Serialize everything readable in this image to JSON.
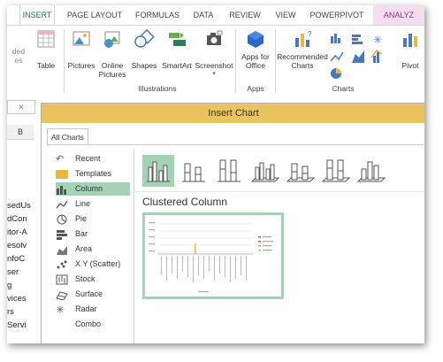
{
  "ribbon": {
    "tabs": [
      "INSERT",
      "PAGE LAYOUT",
      "FORMULAS",
      "DATA",
      "REVIEW",
      "VIEW",
      "POWERPIVOT",
      "ANALYZ"
    ],
    "buttons": {
      "recommended_pivottables": "ded",
      "recommended_sub": "es",
      "table": "Table",
      "pictures": "Pictures",
      "online_pictures_1": "Online",
      "online_pictures_2": "Pictures",
      "shapes": "Shapes",
      "smartart": "SmartArt",
      "screenshot": "Screenshot",
      "apps_for_office_1": "Apps for",
      "apps_for_office_2": "Office",
      "recommended_charts_1": "Recommended",
      "recommended_charts_2": "Charts",
      "pivotchart": "Pivot"
    },
    "groups": {
      "illustrations": "Illustrations",
      "apps": "Apps",
      "charts": "Charts"
    }
  },
  "sheet": {
    "column_b": "B",
    "rows": [
      "sedUs",
      "dCon",
      "itor-A",
      "esolv",
      "nfoC",
      "ser",
      "g",
      "vices",
      "rs",
      "Servi"
    ]
  },
  "dialog": {
    "title": "Insert Chart",
    "tab": "All Charts",
    "categories": [
      "Recent",
      "Templates",
      "Column",
      "Line",
      "Pie",
      "Bar",
      "Area",
      "X Y (Scatter)",
      "Stock",
      "Surface",
      "Radar",
      "Combo"
    ],
    "selected_category": "Column",
    "subtype_title": "Clustered Column"
  },
  "colors": {
    "accent": "#217346",
    "selection": "#a3d3b4",
    "title_bar": "#ecc45f",
    "analyze_tab": "#f6dcef"
  }
}
